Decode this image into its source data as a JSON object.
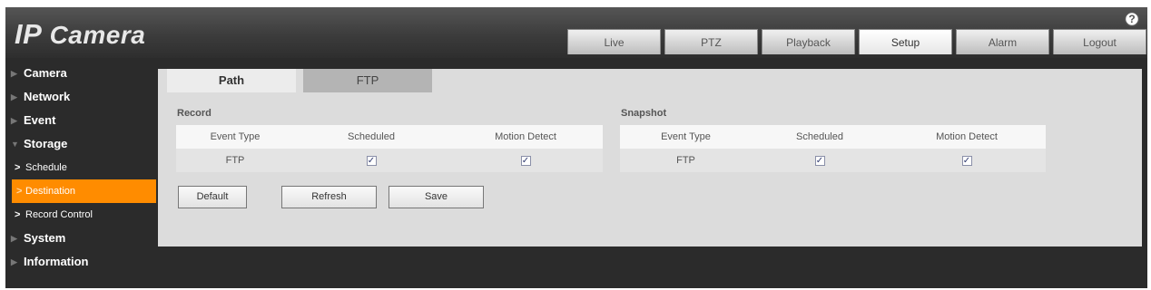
{
  "app": {
    "logo_ip": "IP",
    "logo_camera": " Camera"
  },
  "topnav": [
    {
      "label": "Live",
      "active": false
    },
    {
      "label": "PTZ",
      "active": false
    },
    {
      "label": "Playback",
      "active": false
    },
    {
      "label": "Setup",
      "active": true
    },
    {
      "label": "Alarm",
      "active": false
    },
    {
      "label": "Logout",
      "active": false
    }
  ],
  "sidebar": {
    "camera": "Camera",
    "network": "Network",
    "event": "Event",
    "storage": "Storage",
    "schedule": "Schedule",
    "destination": "Destination",
    "record_control": "Record Control",
    "system": "System",
    "information": "Information"
  },
  "tabs": {
    "path": "Path",
    "ftp": "FTP"
  },
  "record": {
    "title": "Record",
    "headers": [
      "Event Type",
      "Scheduled",
      "Motion Detect"
    ],
    "row": {
      "event_type": "FTP",
      "scheduled": true,
      "motion_detect": true
    }
  },
  "snapshot": {
    "title": "Snapshot",
    "headers": [
      "Event Type",
      "Scheduled",
      "Motion Detect"
    ],
    "row": {
      "event_type": "FTP",
      "scheduled": true,
      "motion_detect": true
    }
  },
  "buttons": {
    "default": "Default",
    "refresh": "Refresh",
    "save": "Save"
  },
  "icons": {
    "help": "help-icon",
    "checkbox": "checkbox-checked-icon"
  },
  "colors": {
    "accent": "#ff8c00",
    "background": "#2b2b2b",
    "panel": "#dcdcdc"
  }
}
